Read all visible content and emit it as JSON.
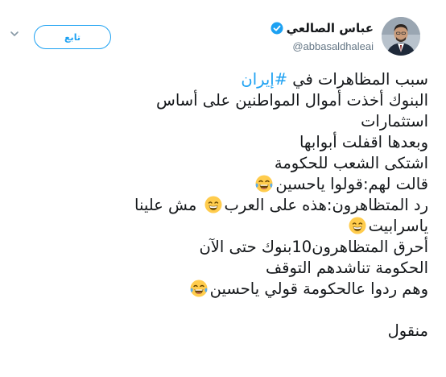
{
  "header": {
    "display_name": "عباس الصالعي",
    "handle": "@abbasaldhaleai",
    "follow_label": "تابع",
    "verified_icon": "verified-badge-icon",
    "chevron_icon": "chevron-down-icon"
  },
  "tweet": {
    "line1_pre": "سبب المظاهرات في ",
    "hashtag": "#إيران",
    "line2": "البنوك أخذت أموال المواطنين على أساس",
    "line3": "استثمارات",
    "line4": "وبعدها اقفلت أبوابها",
    "line5": "اشتكى الشعب للحكومة",
    "line6": "قالت لهم:قولوا ياحسين",
    "line7": "رد المتظاهرون:هذه على العرب",
    "line7b": " مش علينا",
    "line8": "ياسرابيت",
    "line9": "أحرق المتظاهرون10بنوك حتى الآن",
    "line10": "الحكومة تناشدهم التوقف",
    "line11": "وهم ردوا عالحكومة قولي ياحسين",
    "line12": "منقول"
  },
  "emojis": {
    "laughing_tears": "face-with-tears-of-joy-icon",
    "grinning": "grinning-face-with-smiling-eyes-icon"
  },
  "colors": {
    "accent": "#1da1f2",
    "text": "#14171a",
    "muted": "#657786"
  }
}
